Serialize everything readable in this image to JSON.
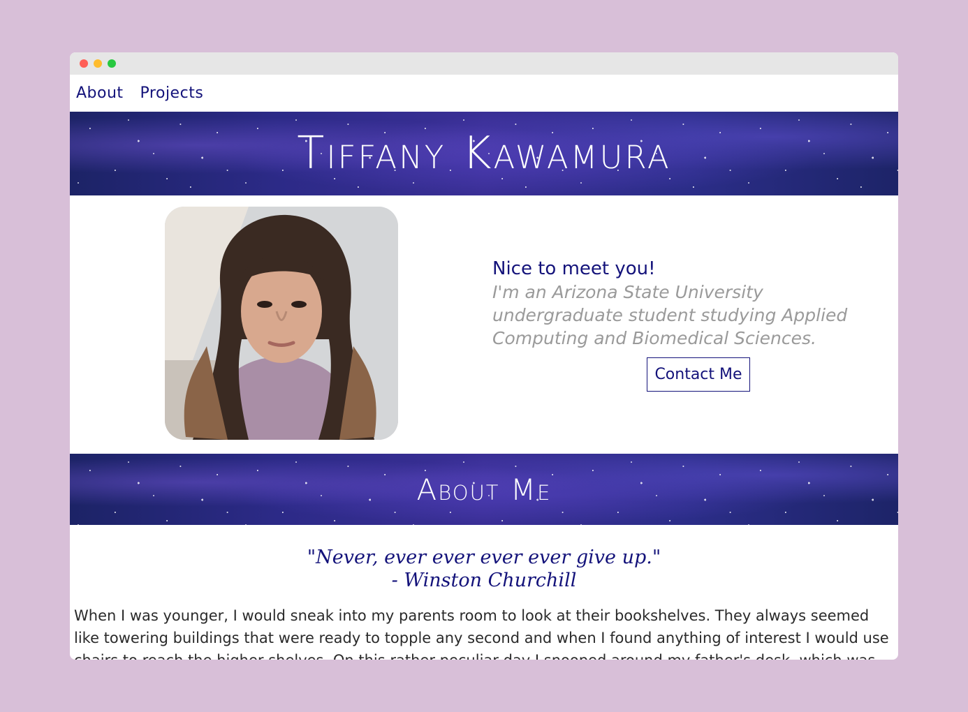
{
  "nav": {
    "items": [
      {
        "label": "About"
      },
      {
        "label": "Projects"
      }
    ]
  },
  "hero": {
    "name": "Tiffany Kawamura"
  },
  "intro": {
    "greeting": "Nice to meet you!",
    "bio": "I'm an Arizona State University undergraduate student studying Applied Computing and Biomedical Sciences.",
    "contact_label": "Contact Me"
  },
  "about": {
    "heading": "About Me",
    "quote_line1": "\"Never, ever ever ever ever give up.\"",
    "quote_line2": "- Winston Churchill",
    "paragraph": "When I was younger, I would sneak into my parents room to look at their bookshelves. They always seemed like towering buildings that were ready to topple any second and when I found anything of interest I would use chairs to reach the higher shelves. On this rather peculiar day I snooped around my father's desk, which was always"
  },
  "colors": {
    "navy": "#13127a",
    "page_background": "#d8bfd8"
  }
}
